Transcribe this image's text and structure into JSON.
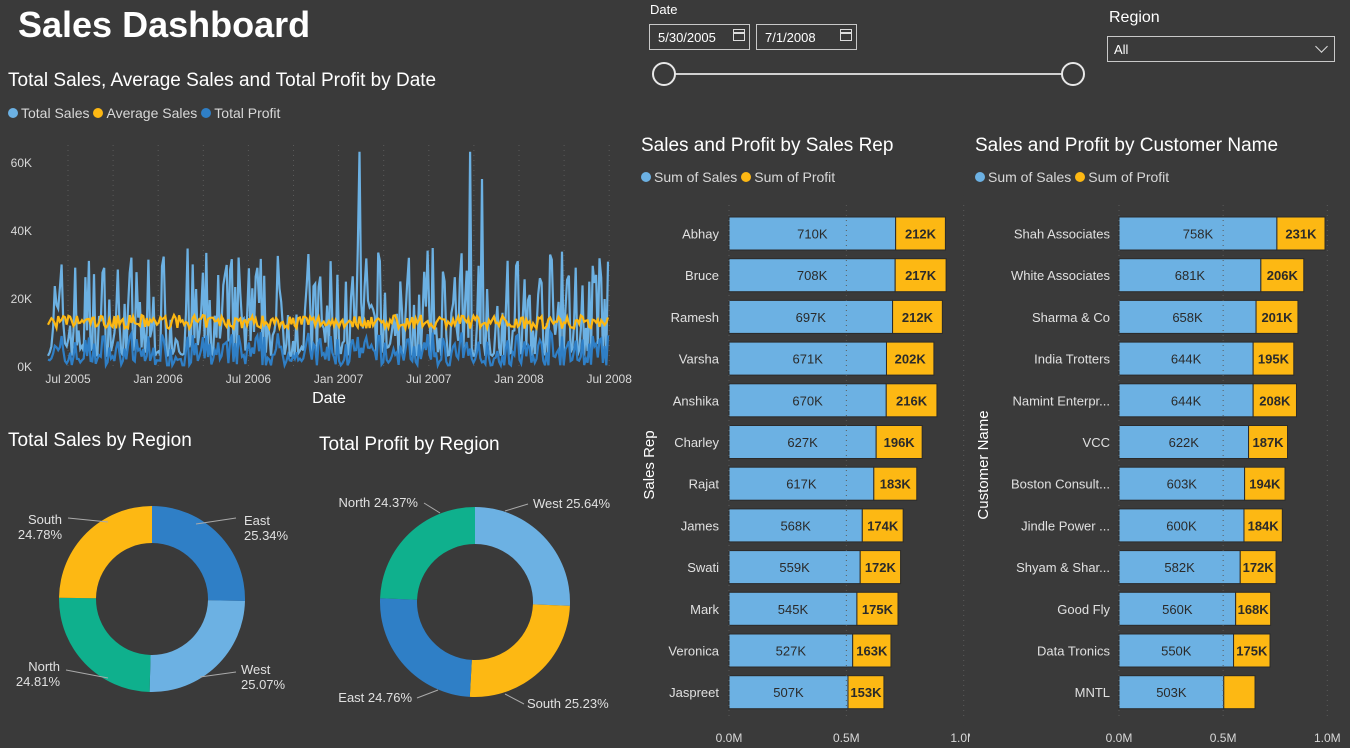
{
  "dashboard": {
    "title": "Sales Dashboard"
  },
  "colors": {
    "background": "#3a3a3a",
    "total_sales": "#6cb1e3",
    "average_sales": "#fdb813",
    "total_profit": "#2f7fc6",
    "east": "#2f7fc6",
    "west": "#6cb1e3",
    "north": "#0fb08d",
    "south": "#fdb813"
  },
  "filters": {
    "date_label": "Date",
    "date_start": "5/30/2005",
    "date_end": "7/1/2008",
    "start_icon": "calendar-icon",
    "end_icon": "calendar-icon",
    "region_label": "Region",
    "region_value": "All",
    "region_icon": "chevron-down-icon"
  },
  "chart_data": [
    {
      "id": "line",
      "type": "line",
      "title": "Total Sales, Average Sales and Total Profit by Date",
      "legend": [
        "Total Sales",
        "Average Sales",
        "Total Profit"
      ],
      "legend_position": "top-left",
      "xlabel": "Date",
      "ylabel": "",
      "x_ticks": [
        "Jul 2005",
        "Jan 2006",
        "Jul 2006",
        "Jan 2007",
        "Jul 2007",
        "Jan 2008",
        "Jul 2008"
      ],
      "y_ticks": [
        "0K",
        "20K",
        "40K",
        "60K"
      ],
      "ylim": [
        0,
        65000
      ],
      "x_range": [
        "2005-05-30",
        "2008-07-01"
      ],
      "grid": "vertical dotted",
      "series_summary": {
        "Total Sales": {
          "typical_min": 3000,
          "typical_max": 35000,
          "peaks": [
            [
              "2007-03",
              63000
            ],
            [
              "2007-11",
              63000
            ],
            [
              "2008-01",
              55000
            ]
          ]
        },
        "Average Sales": {
          "approx_level": 13000,
          "range": [
            10000,
            16000
          ]
        },
        "Total Profit": {
          "approx_level": 4000,
          "range": [
            0,
            10000
          ]
        }
      }
    },
    {
      "id": "sales_region",
      "type": "pie",
      "style": "donut",
      "title": "Total Sales by Region",
      "slices": [
        {
          "label": "East",
          "value": 25.34,
          "pct": "25.34%"
        },
        {
          "label": "West",
          "value": 25.07,
          "pct": "25.07%"
        },
        {
          "label": "North",
          "value": 24.81,
          "pct": "24.81%"
        },
        {
          "label": "South",
          "value": 24.78,
          "pct": "24.78%"
        }
      ]
    },
    {
      "id": "profit_region",
      "type": "pie",
      "style": "donut",
      "title": "Total Profit by Region",
      "slices": [
        {
          "label": "West",
          "value": 25.64,
          "text": "West 25.64%"
        },
        {
          "label": "South",
          "value": 25.23,
          "text": "South 25.23%"
        },
        {
          "label": "East",
          "value": 24.76,
          "text": "East 24.76%"
        },
        {
          "label": "North",
          "value": 24.37,
          "text": "North 24.37%"
        }
      ]
    },
    {
      "id": "rep",
      "type": "bar",
      "orientation": "horizontal",
      "stacked": true,
      "title": "Sales and Profit by Sales Rep",
      "legend": [
        "Sum of Sales",
        "Sum of Profit"
      ],
      "ylabel": "Sales Rep",
      "x_ticks": [
        "0.0M",
        "0.5M",
        "1.0M"
      ],
      "x_tick_values": [
        0,
        500000,
        1000000
      ],
      "xlim": [
        0,
        1000000
      ],
      "categories": [
        "Abhay",
        "Bruce",
        "Ramesh",
        "Varsha",
        "Anshika",
        "Charley",
        "Rajat",
        "James",
        "Swati",
        "Mark",
        "Veronica",
        "Jaspreet"
      ],
      "series": [
        {
          "name": "Sum of Sales",
          "values": [
            710,
            708,
            697,
            671,
            670,
            627,
            617,
            568,
            559,
            545,
            527,
            507
          ],
          "labels": [
            "710K",
            "708K",
            "697K",
            "671K",
            "670K",
            "627K",
            "617K",
            "568K",
            "559K",
            "545K",
            "527K",
            "507K"
          ]
        },
        {
          "name": "Sum of Profit",
          "values": [
            212,
            217,
            212,
            202,
            216,
            196,
            183,
            174,
            172,
            175,
            163,
            153
          ],
          "labels": [
            "212K",
            "217K",
            "212K",
            "202K",
            "216K",
            "196K",
            "183K",
            "174K",
            "172K",
            "175K",
            "163K",
            "153K"
          ]
        }
      ],
      "unit_multiplier": 1000
    },
    {
      "id": "cust",
      "type": "bar",
      "orientation": "horizontal",
      "stacked": true,
      "title": "Sales and Profit by Customer Name",
      "legend": [
        "Sum of Sales",
        "Sum of Profit"
      ],
      "ylabel": "Customer Name",
      "x_ticks": [
        "0.0M",
        "0.5M",
        "1.0M"
      ],
      "x_tick_values": [
        0,
        500000,
        1000000
      ],
      "xlim": [
        0,
        1000000
      ],
      "categories": [
        "Shah Associates",
        "White Associates",
        "Sharma & Co",
        "India Trotters",
        "Namint Enterpr...",
        "VCC",
        "Boston Consult...",
        "Jindle Power ...",
        "Shyam & Shar...",
        "Good Fly",
        "Data Tronics",
        "MNTL"
      ],
      "series": [
        {
          "name": "Sum of Sales",
          "values": [
            758,
            681,
            658,
            644,
            644,
            622,
            603,
            600,
            582,
            560,
            550,
            503
          ],
          "labels": [
            "758K",
            "681K",
            "658K",
            "644K",
            "644K",
            "622K",
            "603K",
            "600K",
            "582K",
            "560K",
            "550K",
            "503K"
          ]
        },
        {
          "name": "Sum of Profit",
          "values": [
            231,
            206,
            201,
            195,
            208,
            187,
            194,
            184,
            172,
            168,
            175,
            150
          ],
          "labels": [
            "231K",
            "206K",
            "201K",
            "195K",
            "208K",
            "187K",
            "194K",
            "184K",
            "172K",
            "168K",
            "175K",
            ""
          ]
        }
      ],
      "unit_multiplier": 1000
    }
  ]
}
